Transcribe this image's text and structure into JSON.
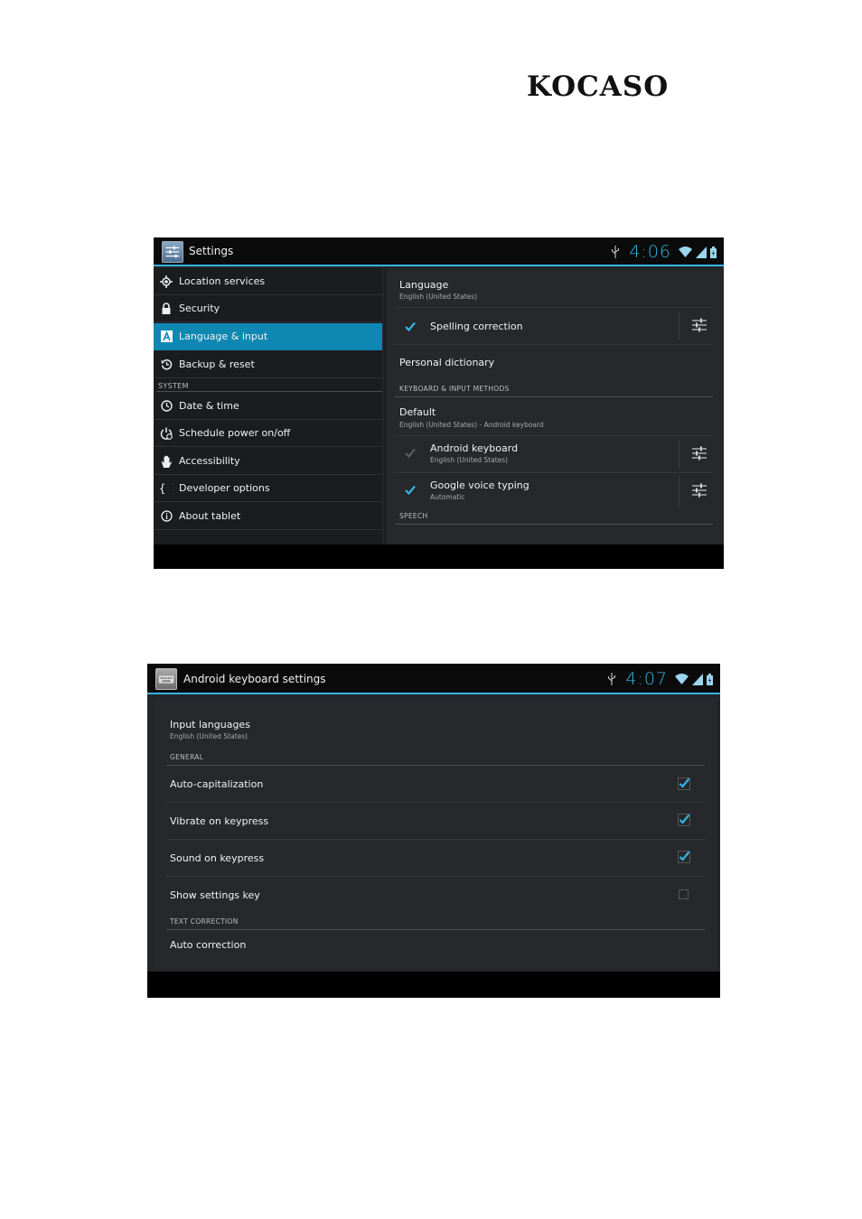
{
  "logo": {
    "text": "KOCASO"
  },
  "colors": {
    "accent": "#33b5e5",
    "selected_item": "#0e87b3",
    "background": "#23252a"
  },
  "screen1": {
    "app_title": "Settings",
    "clock": "4:06",
    "nav": {
      "items": [
        {
          "label": "Location services",
          "icon": "location-icon"
        },
        {
          "label": "Security",
          "icon": "lock-icon"
        },
        {
          "label": "Language & input",
          "icon": "language-icon",
          "selected": true
        },
        {
          "label": "Backup & reset",
          "icon": "backup-icon"
        }
      ],
      "system_header": "SYSTEM",
      "system_items": [
        {
          "label": "Date & time",
          "icon": "clock-icon"
        },
        {
          "label": "Schedule power on/off",
          "icon": "power-schedule-icon"
        },
        {
          "label": "Accessibility",
          "icon": "hand-icon"
        },
        {
          "label": "Developer options",
          "icon": "braces-icon"
        },
        {
          "label": "About tablet",
          "icon": "info-icon"
        }
      ]
    },
    "detail": {
      "language": {
        "title": "Language",
        "summary": "English (United States)"
      },
      "spelling": {
        "title": "Spelling correction",
        "checked": true
      },
      "dictionary": {
        "title": "Personal dictionary"
      },
      "keyboard_header": "KEYBOARD & INPUT METHODS",
      "default": {
        "title": "Default",
        "summary": "English (United States) - Android keyboard"
      },
      "android_keyboard": {
        "title": "Android keyboard",
        "summary": "English (United States)",
        "checked": true,
        "enabled": false
      },
      "voice_typing": {
        "title": "Google voice typing",
        "summary": "Automatic",
        "checked": true
      },
      "speech_header": "SPEECH"
    }
  },
  "screen2": {
    "app_title": "Android keyboard settings",
    "clock": "4:07",
    "input_languages": {
      "title": "Input languages",
      "summary": "English (United States)"
    },
    "general_header": "GENERAL",
    "general_items": [
      {
        "title": "Auto-capitalization",
        "checked": true
      },
      {
        "title": "Vibrate on keypress",
        "checked": true
      },
      {
        "title": "Sound on keypress",
        "checked": true
      },
      {
        "title": "Show settings key",
        "checked": false
      }
    ],
    "text_correction_header": "TEXT CORRECTION",
    "auto_correction": {
      "title": "Auto correction"
    }
  }
}
